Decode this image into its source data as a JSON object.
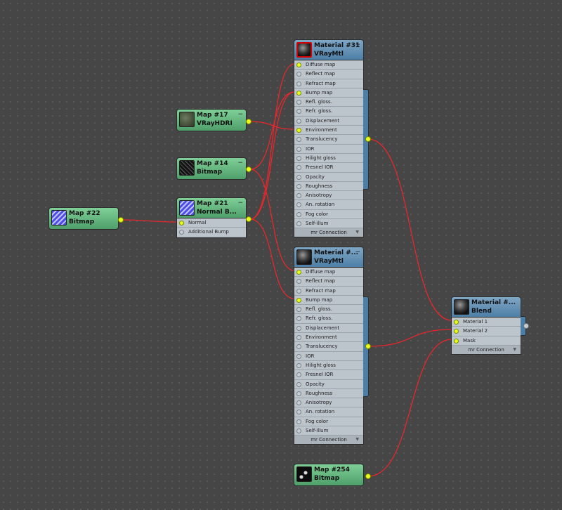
{
  "material_31": {
    "title": "Material #31",
    "type": "VRayMtl",
    "slots": [
      "Diffuse map",
      "Reflect map",
      "Refract map",
      "Bump map",
      "Refl. gloss.",
      "Refr. gloss.",
      "Displacement",
      "Environment",
      "Translucency",
      "IOR",
      "Hilight gloss",
      "Fresnel IOR",
      "Opacity",
      "Roughness",
      "Anisotropy",
      "An. rotation",
      "Fog color",
      "Self-illum"
    ],
    "footer": "mr Connection"
  },
  "material_2": {
    "title": "Material #...",
    "type": "VRayMtl",
    "slots": [
      "Diffuse map",
      "Reflect map",
      "Refract map",
      "Bump map",
      "Refl. gloss.",
      "Refr. gloss.",
      "Displacement",
      "Environment",
      "Translucency",
      "IOR",
      "Hilight gloss",
      "Fresnel IOR",
      "Opacity",
      "Roughness",
      "Anisotropy",
      "An. rotation",
      "Fog color",
      "Self-illum"
    ],
    "footer": "mr Connection"
  },
  "blend": {
    "title": "Material #...",
    "type": "Blend",
    "slots": [
      "Material 1",
      "Material 2",
      "Mask"
    ],
    "footer": "mr Connection"
  },
  "map_17": {
    "title": "Map #17",
    "type": "VRayHDRI"
  },
  "map_14": {
    "title": "Map #14",
    "type": "Bitmap"
  },
  "map_21": {
    "title": "Map #21",
    "type": "Normal B...",
    "slots": [
      "Normal",
      "Additional Bump"
    ]
  },
  "map_22": {
    "title": "Map #22",
    "type": "Bitmap"
  },
  "map_254": {
    "title": "Map #254",
    "type": "Bitmap"
  },
  "colors": {
    "wire": "#e8262b",
    "socket_active": "#e8ff1a",
    "material_header": "#5d8db3",
    "map_header": "#5fb07a",
    "canvas": "#464646"
  }
}
